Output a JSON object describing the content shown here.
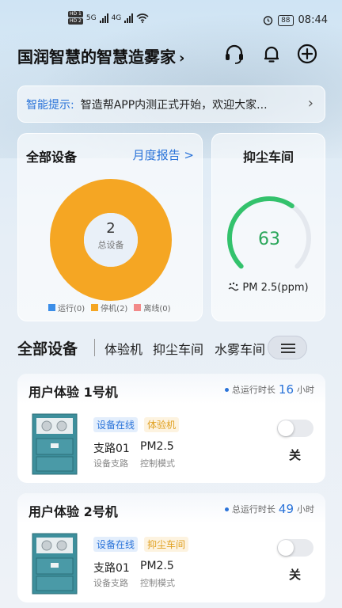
{
  "status": {
    "time": "08:44",
    "battery": "88",
    "hd1": "HD 1",
    "hd2": "HD 2",
    "net1": "5G",
    "net2": "4G"
  },
  "header": {
    "title": "国润智慧的智慧造雾家",
    "chevron": "›",
    "icons": [
      "headset-icon",
      "bell-icon",
      "plus-circle-icon"
    ]
  },
  "tip": {
    "label": "智能提示:",
    "text": "智造帮APP内测正式开始，欢迎大家...",
    "arrow": "›"
  },
  "devices_card": {
    "title": "全部设备",
    "report_link": "月度报告 >",
    "total": "2",
    "total_label": "总设备",
    "legend": [
      {
        "label": "运行(0)",
        "color": "#3b8ee8"
      },
      {
        "label": "停机(2)",
        "color": "#f5a623"
      },
      {
        "label": "离线(0)",
        "color": "#f28a8a"
      }
    ]
  },
  "chart_data": {
    "type": "pie",
    "categories": [
      "运行",
      "停机",
      "离线"
    ],
    "values": [
      0,
      2,
      0
    ],
    "colors": [
      "#3b8ee8",
      "#f5a623",
      "#f28a8a"
    ]
  },
  "dust_card": {
    "title": "抑尘车间",
    "value": "63",
    "gauge_fraction": 0.63,
    "pm_label": "PM 2.5(ppm)"
  },
  "tabs": {
    "main": "全部设备",
    "items": [
      "体验机",
      "抑尘车间",
      "水雾车间"
    ]
  },
  "device_list": [
    {
      "name": "用户体验 1号机",
      "run_label": "总运行时长",
      "run_value": "16",
      "run_unit": "小时",
      "status_badge": "设备在线",
      "type_badge": "体验机",
      "branch": "支路01",
      "branch_label": "设备支路",
      "mode": "PM2.5",
      "mode_label": "控制模式",
      "switch_label": "关"
    },
    {
      "name": "用户体验 2号机",
      "run_label": "总运行时长",
      "run_value": "49",
      "run_unit": "小时",
      "status_badge": "设备在线",
      "type_badge": "抑尘车间",
      "branch": "支路01",
      "branch_label": "设备支路",
      "mode": "PM2.5",
      "mode_label": "控制模式",
      "switch_label": "关"
    }
  ]
}
